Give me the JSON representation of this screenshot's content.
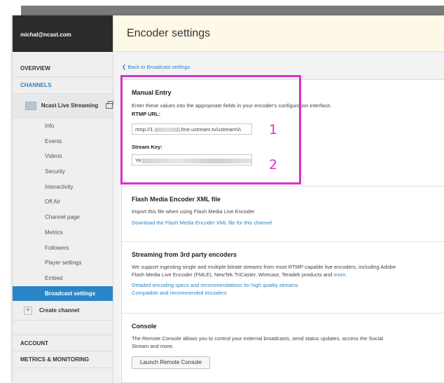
{
  "user": {
    "email": "michal@ncast.com"
  },
  "sidebar": {
    "overview": "OVERVIEW",
    "channels": "CHANNELS",
    "channel_name": "Ncast Live Streaming",
    "items": [
      "Info",
      "Events",
      "Videos",
      "Security",
      "Interactivity",
      "Off Air",
      "Channel page",
      "Metrics",
      "Followers",
      "Player settings",
      "Embed",
      "Broadcast settings"
    ],
    "selected_item": "Broadcast settings",
    "create_channel": "Create channel",
    "account": "ACCOUNT",
    "metrics_monitoring": "METRICS & MONITORING"
  },
  "header": {
    "title": "Encoder settings"
  },
  "back_link": "Back to Broadcast settings",
  "manual_entry": {
    "title": "Manual Entry",
    "description": "Enter these values into the appropriate fields in your encoder's configuration interface.",
    "rtmp_label": "RTMP URL:",
    "rtmp_prefix": "rtmp://1.",
    "rtmp_suffix": ".fme.ustream.tv/ustreamVi",
    "stream_key_label": "Stream Key:",
    "stream_key_prefix": "Ye"
  },
  "annotations": {
    "one": "1",
    "two": "2",
    "color": "#d832c8"
  },
  "flash": {
    "title": "Flash Media Encoder XML file",
    "description": "Import this file when using Flash Media Live Encoder",
    "link": "Download the Flash Media Encoder XML file for this channel"
  },
  "third_party": {
    "title": "Streaming from 3rd party encoders",
    "description_line1": "We support ingesting single and multiple bitrate streams from most RTMP-capable live encoders, including Adobe",
    "description_line2": "Flash Media Live Encoder (FMLE), NewTek TriCaster, Wirecast, Teradek products and",
    "more_link": "more.",
    "link1": "Detailed encoding specs and recommendations for high quality streams",
    "link2": "Compatible and recommended encoders"
  },
  "console": {
    "title": "Console",
    "description_line1": "The Remote Console allows you to control your external broadcasts, send status updates, access the Social",
    "description_line2": "Stream and more.",
    "button": "Launch Remote Console"
  },
  "colors": {
    "accent": "#2a85c7",
    "header_bg": "#fdf8e8",
    "user_bg": "#2b2b2b"
  }
}
